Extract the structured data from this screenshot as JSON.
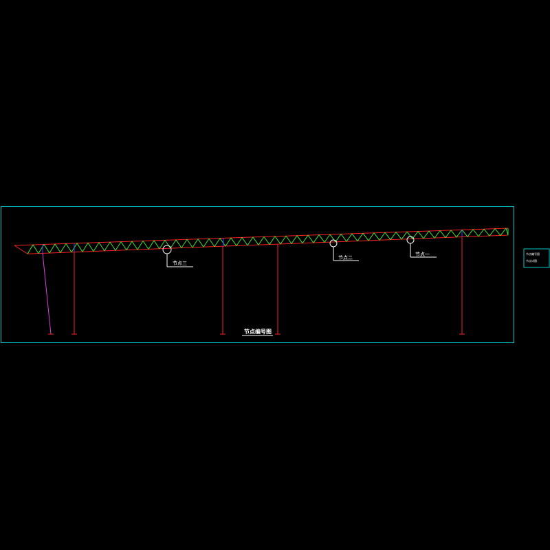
{
  "drawing": {
    "title": "节点编号图",
    "colors": {
      "background": "#000000",
      "frame": "#00c8c8",
      "chord": "#ff2020",
      "web": "#40e040",
      "column": "#ff2020",
      "brace": "#e040e0",
      "vertical_web": "#4040ff",
      "label": "#ffffff"
    },
    "nodes": [
      {
        "id": "node-three",
        "label": "节点三"
      },
      {
        "id": "node-two",
        "label": "节点二"
      },
      {
        "id": "node-one",
        "label": "节点一"
      }
    ],
    "legend": {
      "lines": [
        "节点编号图",
        "节点详图"
      ]
    }
  }
}
